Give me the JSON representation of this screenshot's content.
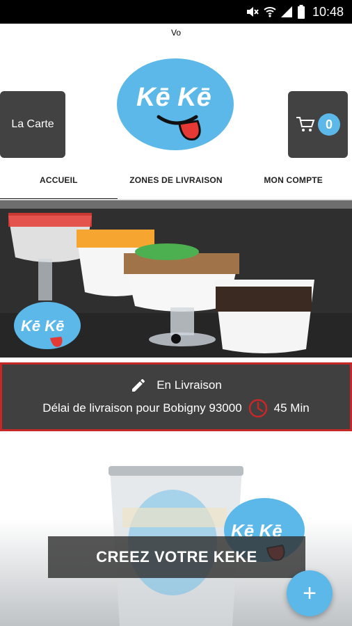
{
  "status_bar": {
    "time": "10:48",
    "icons": [
      "mute-icon",
      "wifi-icon",
      "signal-icon",
      "battery-icon"
    ]
  },
  "header": {
    "title": "Vo",
    "menu_label": "La Carte",
    "cart_count": "0",
    "logo_text": "Kē Kē"
  },
  "tabs": [
    {
      "label": "ACCUEIL",
      "active": true
    },
    {
      "label": "ZONES DE LIVRAISON",
      "active": false
    },
    {
      "label": "MON COMPTE",
      "active": false
    }
  ],
  "banner": {
    "logo_text": "Kē Kē",
    "slides": 1
  },
  "delivery": {
    "mode": "En Livraison",
    "delay_text": "Délai de livraison pour Bobigny 93000",
    "duration": "45 Min"
  },
  "promo": {
    "label": "CREEZ VOTRE KEKE",
    "logo_text": "Kē Kē"
  },
  "fab": {
    "label": "+"
  },
  "colors": {
    "accent": "#5bb8e8",
    "button_bg": "#424242",
    "alert_border": "#c62828",
    "tongue": "#e53935"
  }
}
